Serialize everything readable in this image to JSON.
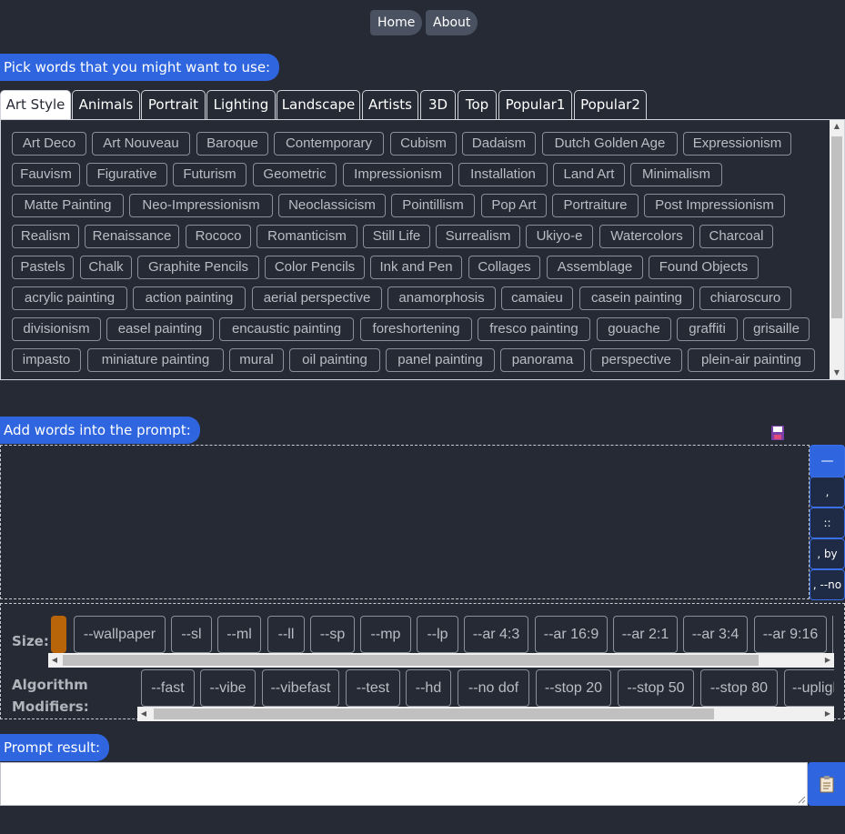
{
  "nav": {
    "home": "Home",
    "about": "About"
  },
  "labels": {
    "pick": "Pick words that you might want to use:",
    "add": "Add words into the prompt:",
    "result": "Prompt result:",
    "size": "Size:",
    "algo_line1": "Algorithm",
    "algo_line2": "Modifiers:"
  },
  "tabs": [
    "Art Style",
    "Animals",
    "Portrait",
    "Lighting",
    "Landscape",
    "Artists",
    "3D",
    "Top",
    "Popular1",
    "Popular2"
  ],
  "active_tab": "Art Style",
  "words": [
    [
      "Art Deco",
      "Art Nouveau",
      "Baroque",
      "Contemporary",
      "Cubism",
      "Dadaism",
      "Dutch Golden Age",
      "Expressionism"
    ],
    [
      "Fauvism",
      "Figurative",
      "Futurism",
      "Geometric",
      "Impressionism",
      "Installation",
      "Land Art",
      "Minimalism"
    ],
    [
      "Matte Painting",
      "Neo-Impressionism",
      "Neoclassicism",
      "Pointillism",
      "Pop Art",
      "Portraiture",
      "Post Impressionism"
    ],
    [
      "Realism",
      "Renaissance",
      "Rococo",
      "Romanticism",
      "Still Life",
      "Surrealism",
      "Ukiyo-e",
      "Watercolors",
      "Charcoal"
    ],
    [
      "Pastels",
      "Chalk",
      "Graphite Pencils",
      "Color Pencils",
      "Ink and Pen",
      "Collages",
      "Assemblage",
      "Found Objects"
    ],
    [
      "acrylic painting",
      "action painting",
      "aerial perspective",
      "anamorphosis",
      "camaieu",
      "casein painting",
      "chiaroscuro"
    ],
    [
      "divisionism",
      "easel painting",
      "encaustic painting",
      "foreshortening",
      "fresco painting",
      "gouache",
      "graffiti",
      "grisaille"
    ],
    [
      "impasto",
      "miniature painting",
      "mural",
      "oil painting",
      "panel painting",
      "panorama",
      "perspective",
      "plein-air painting"
    ]
  ],
  "side_buttons": [
    "—",
    ",",
    "::",
    ", by",
    ", --no"
  ],
  "size_modifiers": [
    "--wallpaper",
    "--sl",
    "--ml",
    "--ll",
    "--sp",
    "--mp",
    "--lp",
    "--ar 4:3",
    "--ar 16:9",
    "--ar 2:1",
    "--ar 3:4",
    "--ar 9:16"
  ],
  "algorithm_modifiers": [
    "--fast",
    "--vibe",
    "--vibefast",
    "--test",
    "--hd",
    "--no dof",
    "--stop 20",
    "--stop 50",
    "--stop 80",
    "--uplight"
  ],
  "colors": {
    "accent": "#2f66e0",
    "background": "#262a34",
    "size_swatch": "#b8650a"
  },
  "icons": {
    "save": "floppy-disk-icon",
    "copy": "clipboard-icon"
  }
}
